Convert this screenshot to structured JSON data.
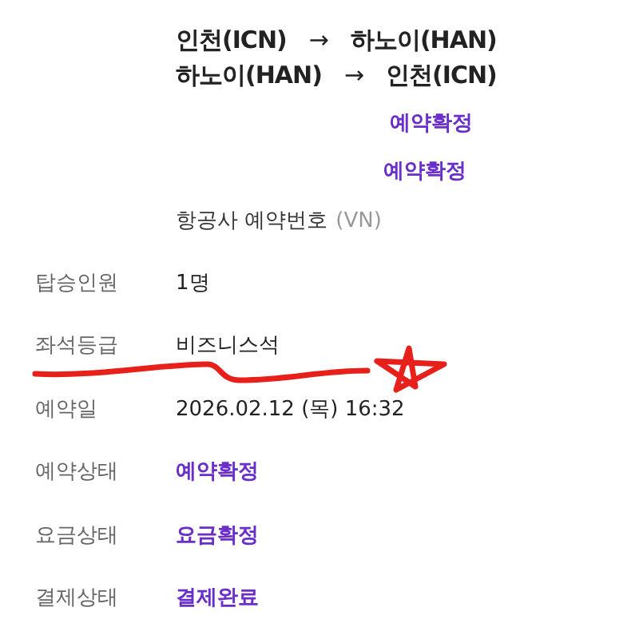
{
  "routes": [
    {
      "from": "인천(ICN)",
      "arrow": "→",
      "to": "하노이(HAN)"
    },
    {
      "from": "하노이(HAN)",
      "arrow": "→",
      "to": "인천(ICN)"
    }
  ],
  "segment_statuses": [
    "예약확정",
    "예약확정"
  ],
  "airline_booking": {
    "label": "항공사 예약번호",
    "code": "(VN)"
  },
  "details": [
    {
      "label": "탑승인원",
      "value": "1명",
      "kind": "text"
    },
    {
      "label": "좌석등급",
      "value": "비즈니스석",
      "kind": "text"
    },
    {
      "label": "예약일",
      "value": "2026.02.12 (목) 16:32",
      "kind": "text"
    },
    {
      "label": "예약상태",
      "value": "예약확정",
      "kind": "status"
    },
    {
      "label": "요금상태",
      "value": "요금확정",
      "kind": "status"
    },
    {
      "label": "결제상태",
      "value": "결제완료",
      "kind": "status"
    }
  ]
}
